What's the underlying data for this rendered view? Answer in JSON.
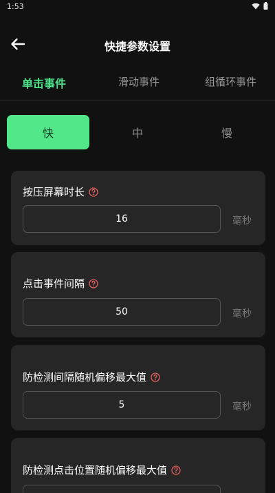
{
  "status_bar": {
    "time": "1:53"
  },
  "header": {
    "title": "快捷参数设置"
  },
  "tabs": [
    {
      "label": "单击事件",
      "active": true
    },
    {
      "label": "滑动事件",
      "active": false
    },
    {
      "label": "组循环事件",
      "active": false
    }
  ],
  "speed_options": [
    {
      "label": "快",
      "active": true
    },
    {
      "label": "中",
      "active": false
    },
    {
      "label": "慢",
      "active": false
    }
  ],
  "settings": [
    {
      "label": "按压屏幕时长",
      "value": "16",
      "unit": "毫秒"
    },
    {
      "label": "点击事件间隔",
      "value": "50",
      "unit": "毫秒"
    },
    {
      "label": "防检测间隔随机偏移最大值",
      "value": "5",
      "unit": "毫秒"
    },
    {
      "label": "防检测点击位置随机偏移最大值",
      "value": "",
      "unit": ""
    }
  ],
  "colors": {
    "accent": "#52e88a",
    "background": "#111111",
    "card": "#262626",
    "help_icon": "#e35d5d"
  }
}
